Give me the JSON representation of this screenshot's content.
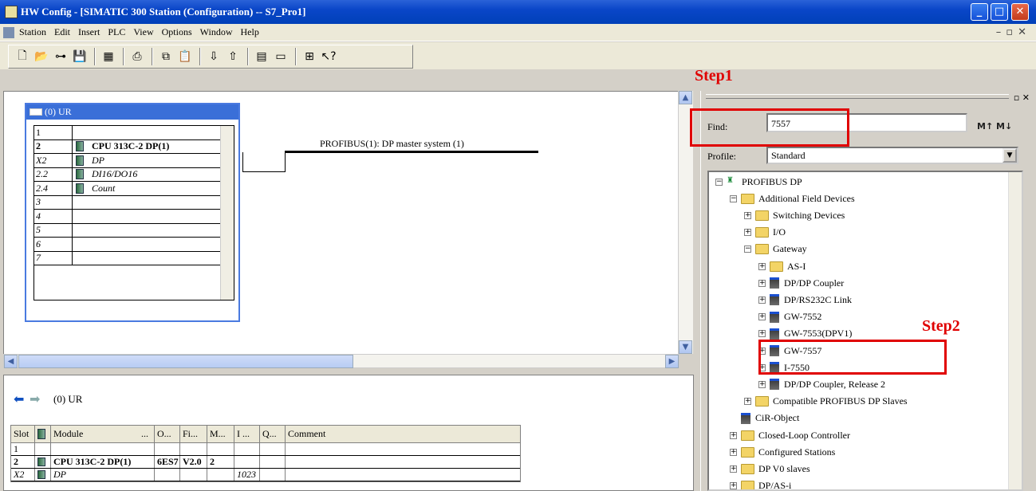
{
  "window": {
    "title": "HW Config - [SIMATIC 300 Station (Configuration) -- S7_Pro1]"
  },
  "menu": [
    "Station",
    "Edit",
    "Insert",
    "PLC",
    "View",
    "Options",
    "Window",
    "Help"
  ],
  "annotations": {
    "step1": "Step1",
    "step2": "Step2"
  },
  "rack": {
    "title": "(0) UR",
    "rows": [
      {
        "slot": "1",
        "module": ""
      },
      {
        "slot": "2",
        "module": "CPU 313C-2 DP(1)"
      },
      {
        "slot": "X2",
        "module": "DP"
      },
      {
        "slot": "2.2",
        "module": "DI16/DO16"
      },
      {
        "slot": "2.4",
        "module": "Count"
      },
      {
        "slot": "3",
        "module": ""
      },
      {
        "slot": "4",
        "module": ""
      },
      {
        "slot": "5",
        "module": ""
      },
      {
        "slot": "6",
        "module": ""
      },
      {
        "slot": "7",
        "module": ""
      }
    ]
  },
  "profibus": {
    "label": "PROFIBUS(1): DP master system (1)"
  },
  "detail": {
    "title": "(0)  UR",
    "headers": [
      "Slot",
      "",
      "Module",
      "...",
      "O...",
      "Fi...",
      "M...",
      "I ...",
      "Q...",
      "Comment"
    ],
    "rows": [
      {
        "slot": "1",
        "module": "",
        "order": "",
        "fw": "",
        "mpi": "",
        "i": ""
      },
      {
        "slot": "2",
        "module": "CPU 313C-2 DP(1)",
        "order": "6ES7",
        "fw": "V2.0",
        "mpi": "2",
        "i": ""
      },
      {
        "slot": "X2",
        "module": "DP",
        "order": "",
        "fw": "",
        "mpi": "",
        "i": "1023"
      }
    ]
  },
  "catalog": {
    "find_label": "Find:",
    "find_value": "7557",
    "profile_label": "Profile:",
    "profile_value": "Standard",
    "tree": [
      {
        "label": "PROFIBUS DP",
        "level": 0,
        "kind": "pb",
        "sign": "−"
      },
      {
        "label": "Additional Field Devices",
        "level": 1,
        "kind": "folder",
        "sign": "−"
      },
      {
        "label": "Switching Devices",
        "level": 2,
        "kind": "folder",
        "sign": "+"
      },
      {
        "label": "I/O",
        "level": 2,
        "kind": "folder",
        "sign": "+"
      },
      {
        "label": "Gateway",
        "level": 2,
        "kind": "folder",
        "sign": "−"
      },
      {
        "label": "AS-I",
        "level": 3,
        "kind": "folder",
        "sign": "+"
      },
      {
        "label": "DP/DP Coupler",
        "level": 3,
        "kind": "dev",
        "sign": "+"
      },
      {
        "label": "DP/RS232C Link",
        "level": 3,
        "kind": "dev",
        "sign": "+"
      },
      {
        "label": "GW-7552",
        "level": 3,
        "kind": "dev",
        "sign": "+"
      },
      {
        "label": "GW-7553(DPV1)",
        "level": 3,
        "kind": "dev",
        "sign": "+"
      },
      {
        "label": "GW-7557",
        "level": 3,
        "kind": "dev",
        "sign": "+"
      },
      {
        "label": "I-7550",
        "level": 3,
        "kind": "dev",
        "sign": "+"
      },
      {
        "label": "DP/DP Coupler, Release 2",
        "level": 3,
        "kind": "dev",
        "sign": "+"
      },
      {
        "label": "Compatible PROFIBUS DP Slaves",
        "level": 2,
        "kind": "folder",
        "sign": "+"
      },
      {
        "label": "CiR-Object",
        "level": 1,
        "kind": "dev",
        "sign": ""
      },
      {
        "label": "Closed-Loop Controller",
        "level": 1,
        "kind": "folder",
        "sign": "+"
      },
      {
        "label": "Configured Stations",
        "level": 1,
        "kind": "folder",
        "sign": "+"
      },
      {
        "label": "DP V0 slaves",
        "level": 1,
        "kind": "folder",
        "sign": "+"
      },
      {
        "label": "DP/AS-i",
        "level": 1,
        "kind": "folder",
        "sign": "+"
      }
    ]
  }
}
